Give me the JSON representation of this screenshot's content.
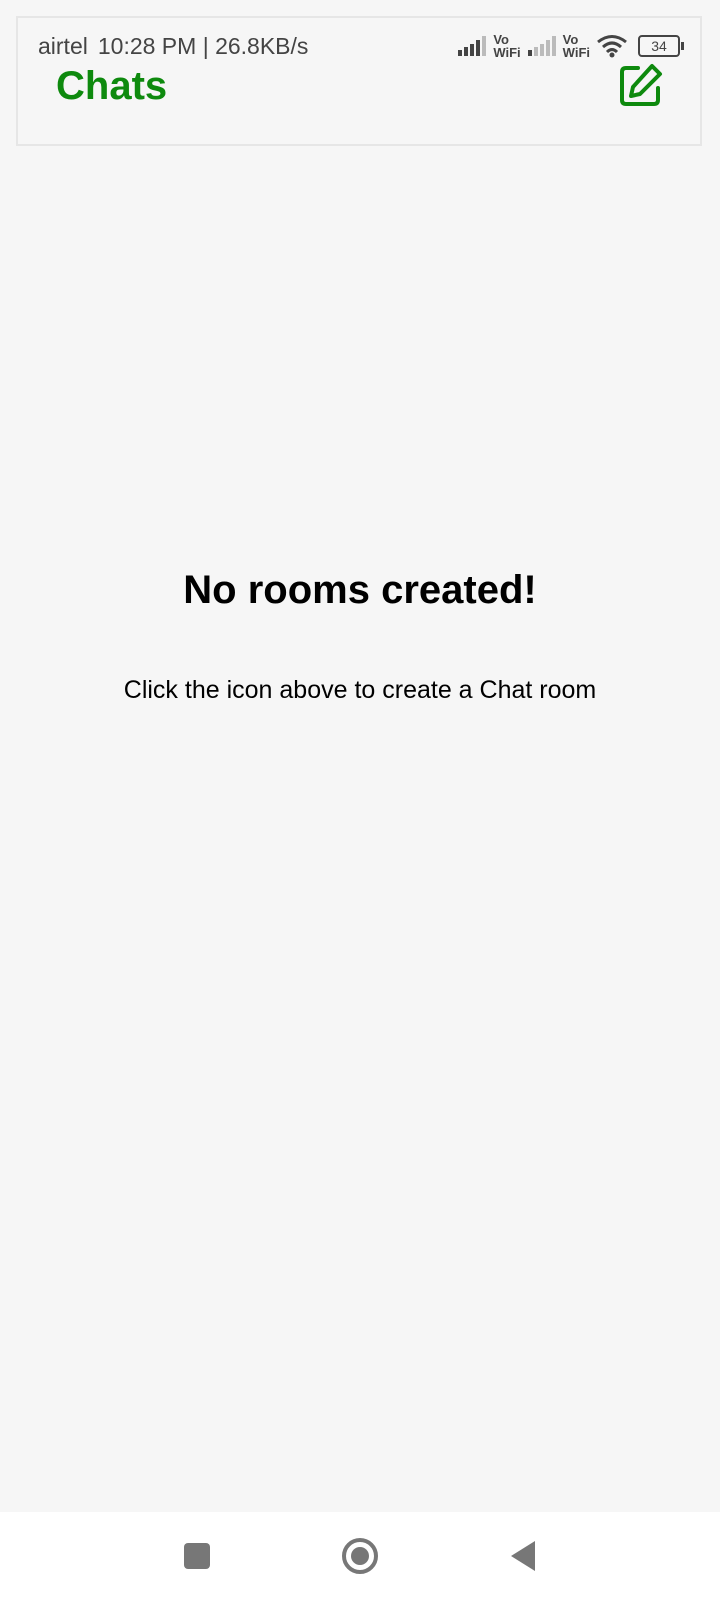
{
  "status_bar": {
    "carrier": "airtel",
    "time": "10:28 PM",
    "separator": "|",
    "speed": "26.8KB/s",
    "vowifi_top": "Vo",
    "vowifi_bottom": "WiFi",
    "battery": "34",
    "icons": [
      "signal-icon",
      "vowifi-icon",
      "signal-icon",
      "vowifi-icon",
      "wifi-icon",
      "battery-icon"
    ]
  },
  "header": {
    "title": "Chats",
    "compose_icon": "compose-icon"
  },
  "empty_state": {
    "title": "No rooms created!",
    "hint": "Click the icon above to create a Chat room"
  },
  "nav_bar": {
    "icons": [
      "recents-icon",
      "home-icon",
      "back-icon"
    ]
  },
  "colors": {
    "accent": "#0e8a0e",
    "background": "#f6f6f6",
    "nav_background": "#ffffff",
    "nav_icon": "#777777"
  }
}
